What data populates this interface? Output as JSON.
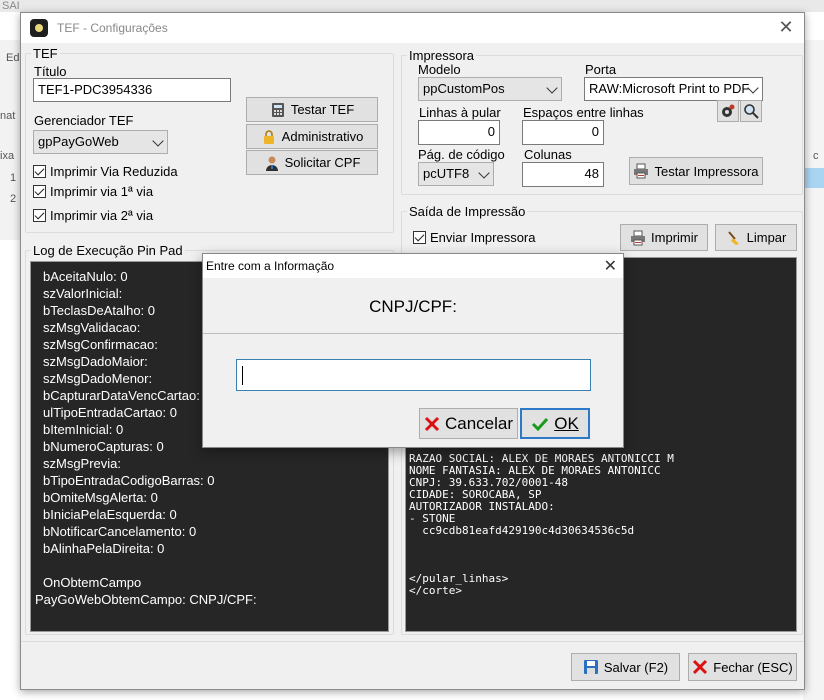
{
  "background_app": {
    "top_label": "SAI",
    "side_labels": [
      "Ed",
      "nat",
      "ixa",
      "1",
      "2"
    ],
    "right_label": "c"
  },
  "window": {
    "title": "TEF - Configurações",
    "tef_group": {
      "title": "TEF",
      "titulo_label": "Título",
      "titulo_value": "TEF1-PDC3954336",
      "gerenciador_label": "Gerenciador TEF",
      "gerenciador_value": "gpPayGoWeb",
      "buttons": {
        "testar": "Testar TEF",
        "administrativo": "Administrativo",
        "solicitar_cpf": "Solicitar CPF"
      },
      "checkboxes": [
        {
          "label": "Imprimir Via Reduzida",
          "checked": true
        },
        {
          "label": "Imprimir via 1ª via",
          "checked": true
        },
        {
          "label": "Imprimir via 2ª via",
          "checked": true
        }
      ]
    },
    "impressora_group": {
      "title": "Impressora",
      "modelo_label": "Modelo",
      "modelo_value": "ppCustomPos",
      "porta_label": "Porta",
      "porta_value": "RAW:Microsoft Print to PDF",
      "linhas_label": "Linhas à pular",
      "linhas_value": "0",
      "espacos_label": "Espaços entre linhas",
      "espacos_value": "0",
      "pag_label": "Pág. de código",
      "pag_value": "pcUTF8",
      "colunas_label": "Colunas",
      "colunas_value": "48",
      "testar_impressora": "Testar Impressora"
    },
    "log_group": {
      "title": "Log de Execução Pin Pad",
      "lines": [
        "bAceitaNulo: 0",
        "szValorInicial:",
        "bTeclasDeAtalho: 0",
        "szMsgValidacao:",
        "szMsgConfirmacao:",
        "szMsgDadoMaior:",
        "szMsgDadoMenor:",
        "bCapturarDataVencCartao:",
        "ulTipoEntradaCartao: 0",
        "bItemInicial: 0",
        "bNumeroCapturas: 0",
        "szMsgPrevia:",
        "bTipoEntradaCodigoBarras: 0",
        "bOmiteMsgAlerta: 0",
        "bIniciaPelaEsquerda: 0",
        "bNotificarCancelamento: 0",
        "bAlinhaPelaDireita: 0",
        "",
        "OnObtemCampo",
        "PayGoWebObtemCampo: CNPJ/CPF:"
      ]
    },
    "saida_group": {
      "title": "Saída de Impressão",
      "enviar_label": "Enviar Impressora",
      "imprimir": "Imprimir",
      "limpar": "Limpar",
      "lines": [
        "RAZAO SOCIAL: ALEX DE MORAES ANTONICCI M",
        "NOME FANTASIA: ALEX DE MORAES ANTONICC",
        "CNPJ: 39.633.702/0001-48",
        "CIDADE: SOROCABA, SP",
        "AUTORIZADOR INSTALADO:",
        "- STONE",
        "  cc9cdb81eafd429190c4d30634536c5d",
        "",
        "",
        "",
        "</pular_linhas>",
        "</corte>"
      ]
    },
    "footer": {
      "salvar": "Salvar (F2)",
      "fechar": "Fechar (ESC)"
    }
  },
  "dialog": {
    "title": "Entre com a Informação",
    "prompt": "CNPJ/CPF:",
    "input_value": "",
    "cancelar": "Cancelar",
    "ok": "OK"
  }
}
